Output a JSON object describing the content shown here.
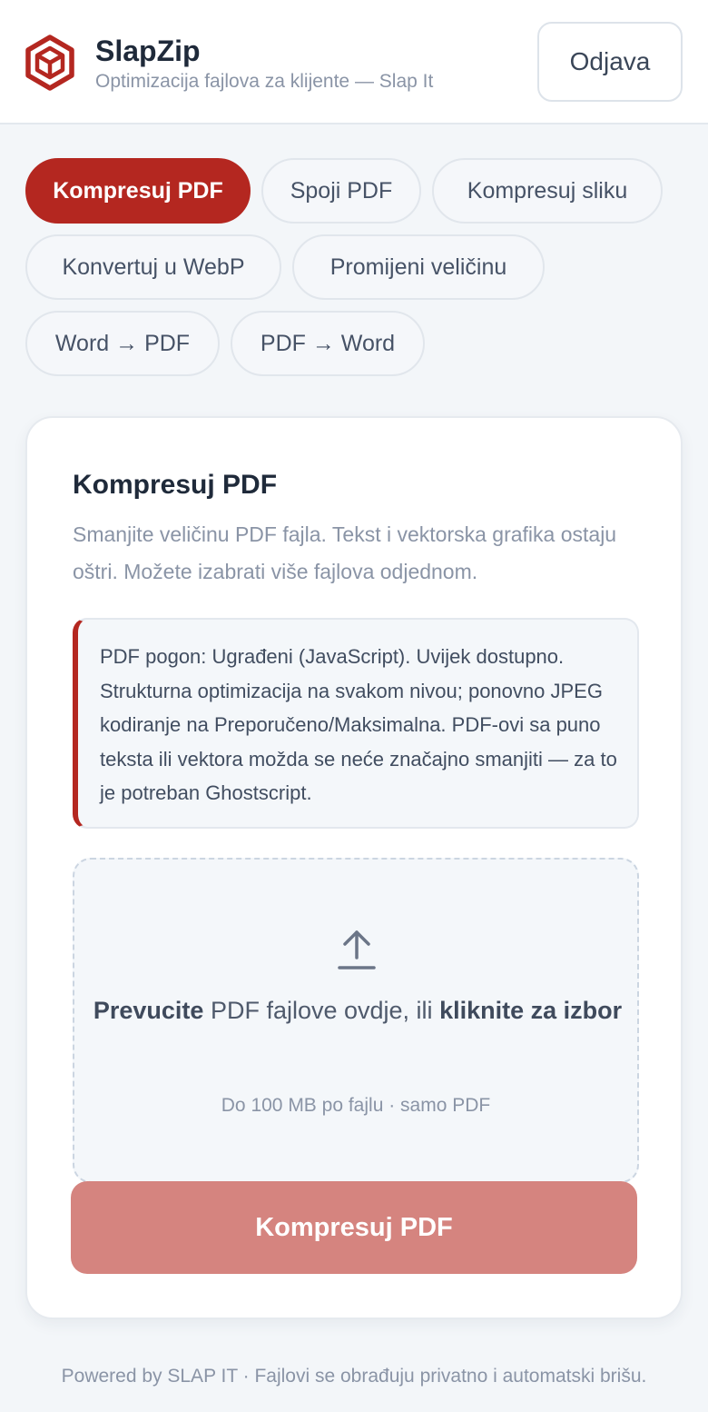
{
  "header": {
    "brand_name": "SlapZip",
    "brand_subtitle": "Optimizacija fajlova za klijente — Slap It",
    "logout_label": "Odjava",
    "logo_icon": "hexagon-cube-logo-icon",
    "brand_color": "#b42720"
  },
  "tabs": [
    {
      "label": "Kompresuj PDF",
      "active": true
    },
    {
      "label": "Spoji PDF",
      "active": false
    },
    {
      "label": "Kompresuj sliku",
      "active": false
    },
    {
      "label": "Konvertuj u WebP",
      "active": false
    },
    {
      "label": "Promijeni veličinu",
      "active": false
    },
    {
      "label": "Word → PDF",
      "active": false
    },
    {
      "label": "PDF → Word",
      "active": false
    }
  ],
  "card": {
    "title": "Kompresuj PDF",
    "description": "Smanjite veličinu PDF fajla. Tekst i vektorska grafika ostaju oštri. Možete izabrati više fajlova odjednom.",
    "notice": "PDF pogon: Ugrađeni (JavaScript). Uvijek dostupno. Strukturna optimizacija na svakom nivou; ponovno JPEG kodiranje na Preporučeno/Maksimalna. PDF-ovi sa puno teksta ili vektora možda se neće značajno smanjiti — za to je potreban Ghostscript.",
    "dropzone": {
      "icon": "upload-icon",
      "drag_strong": "Prevucite",
      "drag_text": " PDF fajlove ovdje, ili ",
      "click_strong": "kliknite za izbor",
      "hint": "Do 100 MB po fajlu · samo PDF"
    },
    "submit_label": "Kompresuj PDF"
  },
  "footer": {
    "text": "Powered by SLAP IT · Fajlovi se obrađuju privatno i automatski brišu."
  }
}
